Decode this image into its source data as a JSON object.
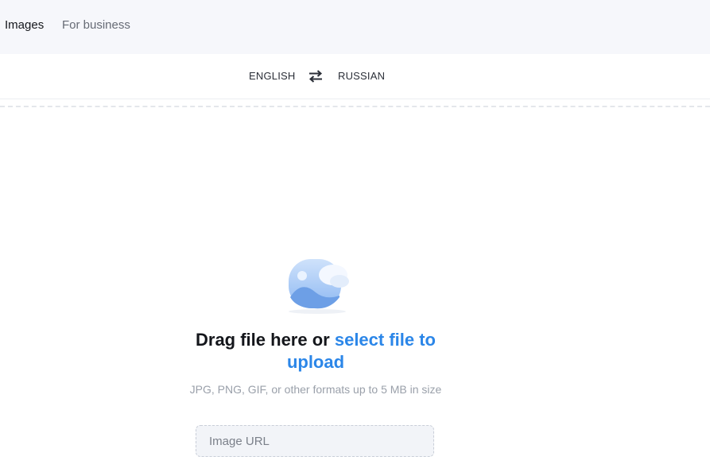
{
  "header": {
    "tabs": [
      {
        "label": "Images"
      },
      {
        "label": "For business"
      }
    ]
  },
  "languages": {
    "source": "ENGLISH",
    "target": "RUSSIAN",
    "swap_icon": "swap-arrows-icon"
  },
  "upload": {
    "icon": "image-placeholder-icon",
    "headline_static": "Drag file here or ",
    "headline_link": "select file to upload",
    "hint": "JPG, PNG, GIF, or other formats up to 5 MB in size",
    "url_placeholder": "Image URL",
    "url_value": ""
  },
  "colors": {
    "accent": "#2b86e8",
    "topbar_bg": "#f6f7fb",
    "input_bg": "#f2f4f8"
  }
}
